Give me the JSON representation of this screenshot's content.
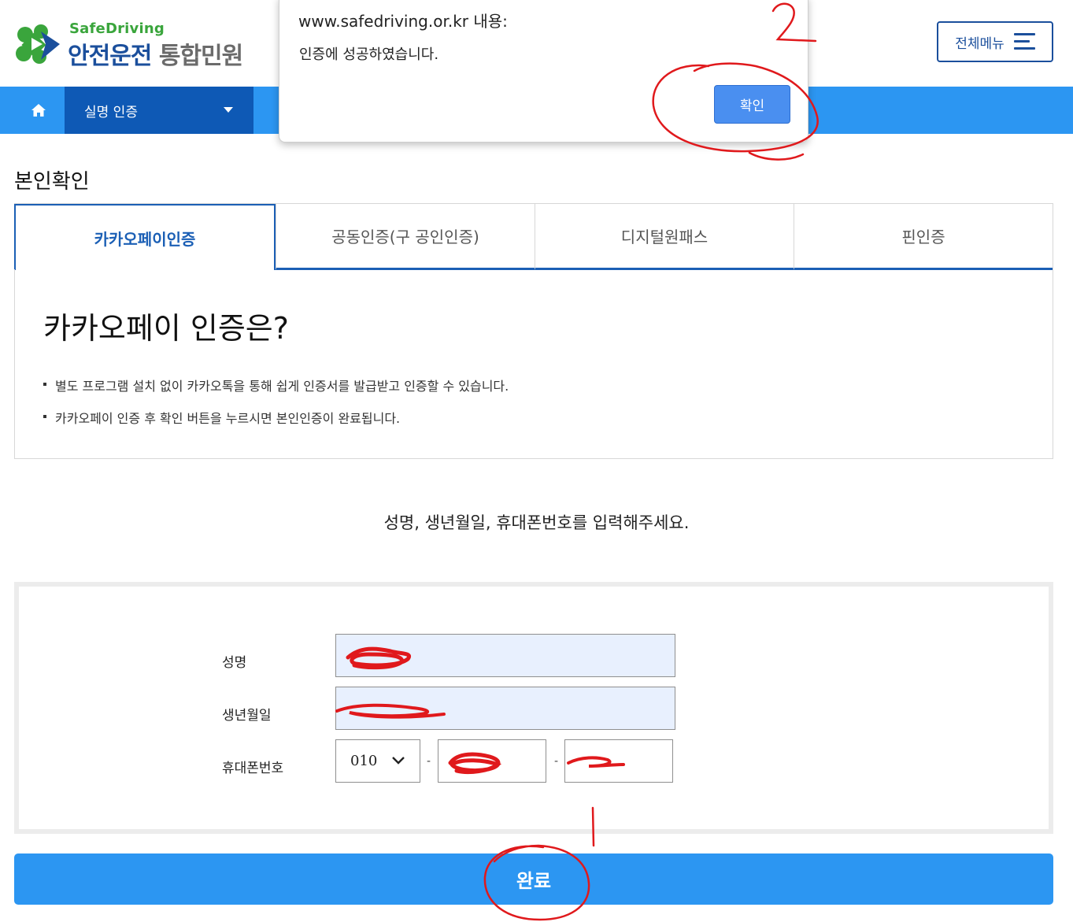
{
  "header": {
    "logo_en": "SafeDriving",
    "logo_ko_primary": "안전운전",
    "logo_ko_secondary": "통합민원",
    "menu_label": "전체메뉴"
  },
  "nav": {
    "home_icon": "home-icon",
    "selected": "실명 인증"
  },
  "page_title": "본인확인",
  "tabs": [
    {
      "label": "카카오페이인증",
      "active": true
    },
    {
      "label": "공동인증(구 공인인증)",
      "active": false
    },
    {
      "label": "디지털원패스",
      "active": false
    },
    {
      "label": "핀인증",
      "active": false
    }
  ],
  "info": {
    "title": "카카오페이 인증은?",
    "items": [
      "별도 프로그램 설치 없이 카카오톡을 통해 쉽게 인증서를 발급받고 인증할 수 있습니다.",
      "카카오페이 인증 후 확인 버튼을 누르시면 본인인증이 완료됩니다."
    ]
  },
  "instruction": "성명, 생년월일, 휴대폰번호를 입력해주세요.",
  "form": {
    "name_label": "성명",
    "birth_label": "생년월일",
    "phone_label": "휴대폰번호",
    "phone_prefix": "010",
    "dash": "-"
  },
  "submit_label": "완료",
  "alert": {
    "origin": "www.safedriving.or.kr 내용:",
    "message": "인증에 성공하였습니다.",
    "ok_label": "확인"
  },
  "annotations": {
    "color": "#e0191c",
    "number_1": "1",
    "number_2": "2"
  },
  "colors": {
    "primary_blue": "#2c96f2",
    "dark_blue": "#0e59b5",
    "brand_blue": "#1b4f9c",
    "brand_green": "#3aa53c"
  }
}
